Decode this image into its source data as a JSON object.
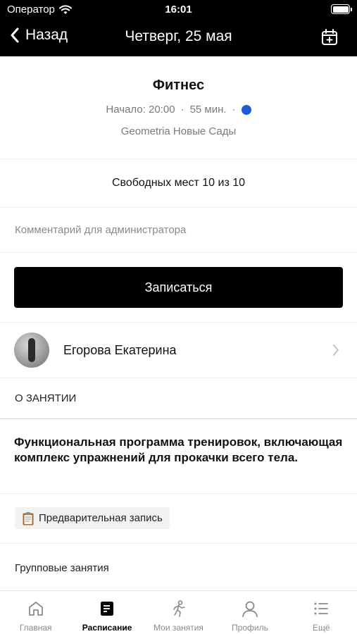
{
  "status_bar": {
    "carrier": "Оператор",
    "time": "16:01"
  },
  "nav": {
    "back_label": "Назад",
    "title": "Четверг, 25 мая"
  },
  "class": {
    "name": "Фитнес",
    "start": "Начало: 20:00",
    "duration": "55 мин.",
    "venue": "Geometria Новые Сады",
    "indicator_color": "#1f5bd6"
  },
  "seats": "Свободных мест 10 из 10",
  "comment": {
    "placeholder": "Комментарий для администратора"
  },
  "signup_label": "Записаться",
  "trainer": {
    "name": "Егорова Екатерина"
  },
  "about": {
    "title": "О ЗАНЯТИИ",
    "description": "Функциональная программа тренировок, включающая комплекс упражнений для прокачки всего тела.",
    "tag": "Предварительная запись",
    "category": "Групповые занятия"
  },
  "tabs": [
    {
      "label": "Главная",
      "icon": "home-icon"
    },
    {
      "label": "Расписание",
      "icon": "schedule-icon"
    },
    {
      "label": "Мои занятия",
      "icon": "runner-icon"
    },
    {
      "label": "Профиль",
      "icon": "profile-icon"
    },
    {
      "label": "Ещё",
      "icon": "more-icon"
    }
  ],
  "active_tab": "Расписание"
}
